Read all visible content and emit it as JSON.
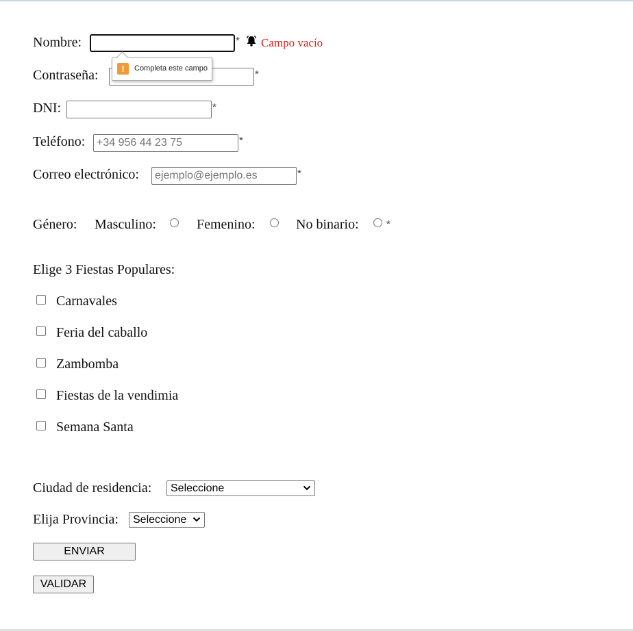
{
  "form": {
    "nombre": {
      "label": "Nombre:",
      "required_mark": "*",
      "value": ""
    },
    "nombre_error": {
      "text": "Campo vacío",
      "icon": "bell-icon",
      "color": "#e0201a"
    },
    "contrasena": {
      "label": "Contraseña:",
      "required_mark": "*",
      "value": ""
    },
    "dni": {
      "label": "DNI:",
      "required_mark": "*",
      "value": ""
    },
    "telefono": {
      "label": "Teléfono:",
      "required_mark": "*",
      "placeholder": "+34 956 44 23 75"
    },
    "correo": {
      "label": "Correo electrónico:",
      "required_mark": "*",
      "placeholder": "ejemplo@ejemplo.es"
    },
    "genero": {
      "label": "Género:",
      "required_mark": "*",
      "options": [
        {
          "label": "Masculino:",
          "checked": false
        },
        {
          "label": "Femenino:",
          "checked": false
        },
        {
          "label": "No binario:",
          "checked": false
        }
      ]
    },
    "fiestas": {
      "label": "Elige 3 Fiestas Populares:",
      "options": [
        {
          "label": "Carnavales",
          "checked": false
        },
        {
          "label": "Feria del caballo",
          "checked": false
        },
        {
          "label": "Zambomba",
          "checked": false
        },
        {
          "label": "Fiestas de la vendimia",
          "checked": false
        },
        {
          "label": "Semana Santa",
          "checked": false
        }
      ]
    },
    "ciudad": {
      "label": "Ciudad de residencia:",
      "selected": "Seleccione"
    },
    "provincia": {
      "label": "Elija Provincia:",
      "selected": "Seleccione"
    },
    "buttons": {
      "enviar": "ENVIAR",
      "validar": "VALIDAR"
    }
  },
  "tooltip": {
    "text": "Completa este campo",
    "icon": "warning-icon",
    "accent": "#f19a38"
  }
}
